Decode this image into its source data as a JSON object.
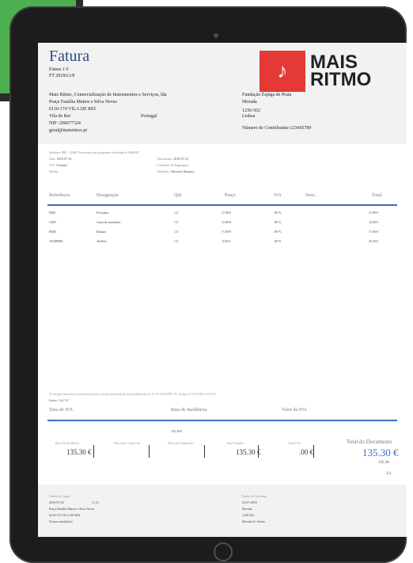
{
  "header": {
    "title": "Fatura",
    "line1": "Fatura  1  0",
    "line2": "FT 2018A1/8",
    "logo_word1": "MAIS",
    "logo_word2": "RITMO"
  },
  "seller": {
    "name": "Mais Ritmo, Comercialização de Instrumentos e Serviços, lda",
    "address": "Praça Família Mattos e Silva Neves",
    "postal": "6110-174 VILA DE REI",
    "city": "Vila de Rei",
    "country": "Portugal",
    "nif": "NIF: 206677324",
    "email": "geral@maisritmo.pt"
  },
  "buyer": {
    "name": "Fundação Espiga de Prata",
    "address_label": "Morada",
    "postal": "1236-562",
    "city": "Lisboa",
    "taxpayer": "Número de Contribuinte:123456789"
  },
  "meta": {
    "software": "Software PHC - 6348, Processado por programa certificado n°0000/AT",
    "date_label": "Data:",
    "date": "2018-07-23",
    "due_label": "Vencimento:",
    "due": "2018-07-23",
    "via_label": "VIA:",
    "via": "Original",
    "payment_label": "Condições de Pagamento:",
    "currency_label": "Moeda",
    "seller_label": "Vendedor:",
    "seller_name": "Albertino Marques"
  },
  "table": {
    "headers": [
      "Referência",
      "Designação",
      "Qtd.",
      "Preço",
      "IVA",
      "Desc.",
      "Total"
    ],
    "rows": [
      [
        "F002",
        "Ferrinhos",
        "1.0",
        "27.00 €",
        ".00 %",
        "",
        "27.00 €"
      ],
      [
        "G003",
        "Guita de assobador",
        "1.0",
        "12.00 €",
        ".00 %",
        "",
        "12.00 €"
      ],
      [
        "B004",
        "Bázuno",
        "1.0",
        "71.00 €",
        ".00 %",
        "",
        "71.00 €"
      ],
      [
        "TAXFREE",
        "TaxFree",
        "1.0",
        "-0.00 €",
        ".00 %",
        "",
        "25.30 €"
      ]
    ]
  },
  "notes": {
    "legal": "Os artigos faturados estiveram presentes isentos (mercadoria disponibilizada em 23-07-2018 (DIV P). Artigo (1.0) (LP (R.1) CIVA)",
    "exemption": "Isento - Art°14°"
  },
  "tax_summary": {
    "col1": "Taxa de IVA",
    "col2": "Base de Incidência",
    "col3": "Valor do IVA",
    "base_value": "135.30 €"
  },
  "totals": {
    "base_label": "Base de Incidência",
    "base_value": "135.30 €",
    "comm_disc_label": "Desconto Comercial",
    "fin_disc_label": "Desconto Financeiro",
    "total_label": "Total Ilíquido",
    "total_value": "135.30 €",
    "vat_label": "Total IVA",
    "vat_value": ".00 €",
    "doc_label": "Total do Documento",
    "doc_value": "135.30 €",
    "doc_sub": "135.30",
    "page": "1/1"
  },
  "footer": {
    "load_label": "Dados de Carga:",
    "load_date": "2018-07-23",
    "load_time": "11:31",
    "load_address": "Praça Família Mattos e Silva Neves",
    "load_postal": "6110-174 VILA DE REI",
    "load_note": "Nossas instalações",
    "unload_label": "Dados de Descarga:",
    "unload_date": "23-07-2018",
    "unload_addr_label": "Morada",
    "unload_postal": "1236-562",
    "unload_note": "Morada do cliente"
  }
}
